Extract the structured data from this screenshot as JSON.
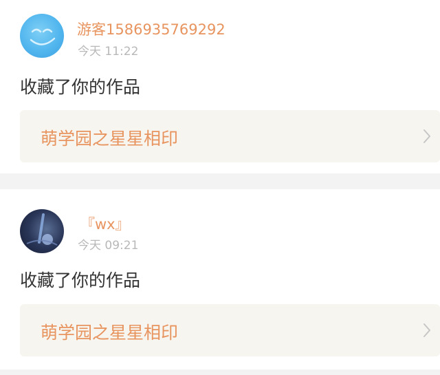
{
  "feed": [
    {
      "username": "游客1586935769292",
      "time": "今天 11:22",
      "action": "收藏了你的作品",
      "work_title": "萌学园之星星相印"
    },
    {
      "username": "『wx』",
      "time": "今天 09:21",
      "action": "收藏了你的作品",
      "work_title": "萌学园之星星相印"
    }
  ],
  "colors": {
    "accent": "#e8945f",
    "muted": "#b8b8b8",
    "text": "#333333",
    "work_box_bg": "#f6f5ef",
    "page_bg": "#f3f3f3"
  }
}
